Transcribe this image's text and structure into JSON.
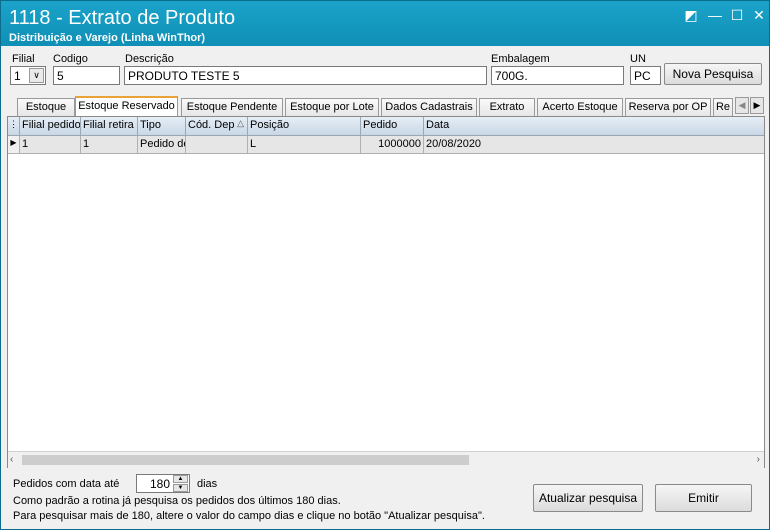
{
  "window": {
    "title": "1118 - Extrato de Produto",
    "subtitle": "Distribuição e Varejo (Linha WinThor)",
    "restore_icon": "◩",
    "minimize_icon": "—",
    "maximize_icon": "☐",
    "close_icon": "✕"
  },
  "form": {
    "filial_label": "Filial",
    "filial_value": "1",
    "codigo_label": "Codigo",
    "codigo_value": "5",
    "descricao_label": "Descrição",
    "descricao_value": "PRODUTO TESTE 5",
    "embalagem_label": "Embalagem",
    "embalagem_value": "700G.",
    "un_label": "UN",
    "un_value": "PC",
    "nova_pesquisa": "Nova Pesquisa"
  },
  "tabs": [
    {
      "label": "Estoque"
    },
    {
      "label": "Estoque Reservado"
    },
    {
      "label": "Estoque Pendente"
    },
    {
      "label": "Estoque por Lote"
    },
    {
      "label": "Dados Cadastrais"
    },
    {
      "label": "Extrato"
    },
    {
      "label": "Acerto Estoque"
    },
    {
      "label": "Reserva por OP"
    },
    {
      "label": "Re"
    }
  ],
  "grid": {
    "columns": [
      "Filial pedido",
      "Filial retira",
      "Tipo",
      "Cód. Dep",
      "Posição",
      "Pedido",
      "Data"
    ],
    "sort_icon": "△",
    "rows": [
      {
        "filial_pedido": "1",
        "filial_retira": "1",
        "tipo": "Pedido de",
        "cod_dep": "",
        "posicao": "L",
        "pedido": "1000000",
        "data": "20/08/2020"
      }
    ]
  },
  "bottom": {
    "pedidos_label": "Pedidos com data até",
    "dias_value": "180",
    "dias_label": "dias",
    "info_line1": "Como padrão a rotina já pesquisa os pedidos dos últimos 180 dias.",
    "info_line2": "Para pesquisar mais de 180, altere o valor do campo dias e clique no botão \"Atualizar pesquisa\".",
    "atualizar": "Atualizar pesquisa",
    "emitir": "Emitir"
  }
}
